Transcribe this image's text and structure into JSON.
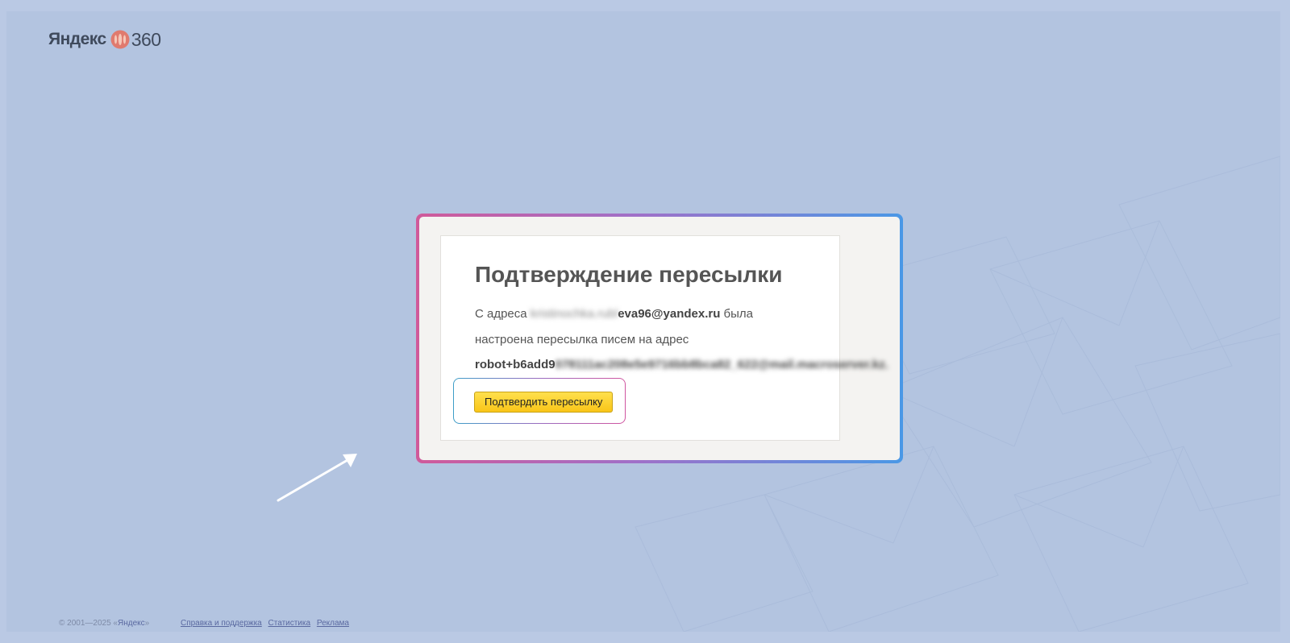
{
  "logo": {
    "brand": "Яндекс",
    "number": "360"
  },
  "card": {
    "title": "Подтверждение пересылки",
    "line1_prefix": "С адреса ",
    "source_email_hidden": "kristinochka.rubl",
    "source_email_visible": "eva96@yandex.ru",
    "line1_suffix": " была",
    "line2": "настроена пересылка писем на адрес",
    "target_email_visible": "robot+b6add9",
    "target_email_hidden": "078111ac208e5e9716bb8bca82_622@mail.macroserver.kz.",
    "confirm_button": "Подтвердить пересылку"
  },
  "footer": {
    "copyright_prefix": "© 2001—2025 «",
    "copyright_link": "Яндекс",
    "copyright_suffix": "»",
    "links": [
      "Справка и поддержка",
      "Статистика",
      "Реклама"
    ]
  },
  "colors": {
    "page_bg": "#bac9e4",
    "card_gradient_start": "#d05a9a",
    "card_gradient_end": "#4a98e6",
    "button_yellow": "#ffd83a",
    "logo_mark": "#e07a6e"
  }
}
